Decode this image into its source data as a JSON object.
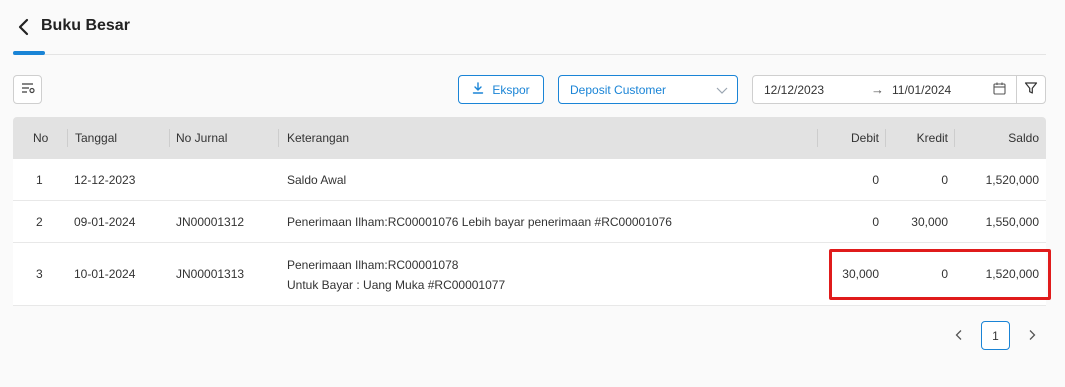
{
  "header": {
    "title": "Buku Besar"
  },
  "toolbar": {
    "export_label": "Ekspor",
    "account_select": "Deposit Customer",
    "date_start": "12/12/2023",
    "date_arrow": "→",
    "date_end": "11/01/2024"
  },
  "table": {
    "columns": [
      "No",
      "Tanggal",
      "No Jurnal",
      "Keterangan",
      "Debit",
      "Kredit",
      "Saldo"
    ],
    "rows": [
      {
        "no": "1",
        "tanggal": "12-12-2023",
        "no_jurnal": "",
        "keterangan": [
          "Saldo Awal"
        ],
        "debit": "0",
        "kredit": "0",
        "saldo": "1,520,000"
      },
      {
        "no": "2",
        "tanggal": "09-01-2024",
        "no_jurnal": "JN00001312",
        "keterangan": [
          "Penerimaan Ilham:RC00001076 Lebih bayar penerimaan #RC00001076"
        ],
        "debit": "0",
        "kredit": "30,000",
        "saldo": "1,550,000"
      },
      {
        "no": "3",
        "tanggal": "10-01-2024",
        "no_jurnal": "JN00001313",
        "keterangan": [
          "Penerimaan Ilham:RC00001078",
          "Untuk Bayar : Uang Muka #RC00001077"
        ],
        "debit": "30,000",
        "kredit": "0",
        "saldo": "1,520,000"
      }
    ]
  },
  "pagination": {
    "current_page": "1"
  },
  "colors": {
    "accent": "#1a84d6",
    "highlight": "#e01b1b",
    "header_bg": "#e2e2e2"
  }
}
